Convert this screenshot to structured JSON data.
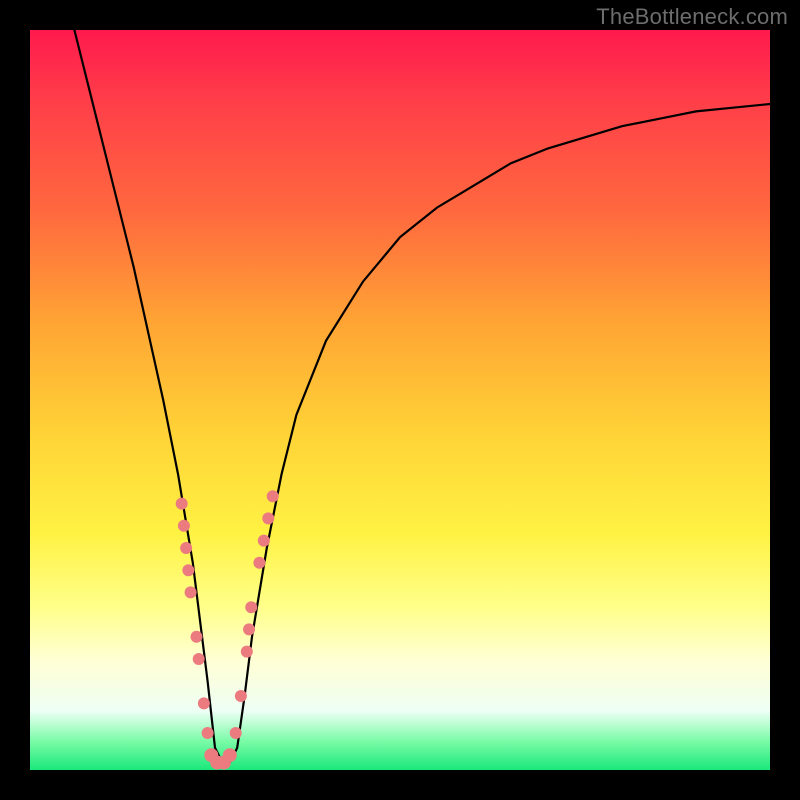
{
  "watermark": "TheBottleneck.com",
  "chart_data": {
    "type": "line",
    "title": "",
    "xlabel": "",
    "ylabel": "",
    "xlim": [
      0,
      100
    ],
    "ylim": [
      0,
      100
    ],
    "series": [
      {
        "name": "bottleneck-curve",
        "x": [
          6,
          8,
          10,
          12,
          14,
          16,
          18,
          20,
          21,
          22,
          23,
          24,
          25,
          26,
          27,
          28,
          29,
          30,
          32,
          34,
          36,
          40,
          45,
          50,
          55,
          60,
          65,
          70,
          75,
          80,
          85,
          90,
          95,
          100
        ],
        "y": [
          100,
          92,
          84,
          76,
          68,
          59,
          50,
          40,
          34,
          28,
          20,
          12,
          3,
          1,
          1,
          3,
          10,
          18,
          30,
          40,
          48,
          58,
          66,
          72,
          76,
          79,
          82,
          84,
          85.5,
          87,
          88,
          89,
          89.5,
          90
        ]
      }
    ],
    "markers": {
      "name": "highlighted-points",
      "color": "#ec7b80",
      "points": [
        {
          "x": 20.5,
          "y": 36,
          "r": 6
        },
        {
          "x": 20.8,
          "y": 33,
          "r": 6
        },
        {
          "x": 21.1,
          "y": 30,
          "r": 6
        },
        {
          "x": 21.4,
          "y": 27,
          "r": 6
        },
        {
          "x": 21.7,
          "y": 24,
          "r": 6
        },
        {
          "x": 22.5,
          "y": 18,
          "r": 6
        },
        {
          "x": 22.8,
          "y": 15,
          "r": 6
        },
        {
          "x": 23.5,
          "y": 9,
          "r": 6
        },
        {
          "x": 24.0,
          "y": 5,
          "r": 6
        },
        {
          "x": 24.5,
          "y": 2,
          "r": 7
        },
        {
          "x": 25.3,
          "y": 1,
          "r": 7
        },
        {
          "x": 26.2,
          "y": 1,
          "r": 7
        },
        {
          "x": 27.0,
          "y": 2,
          "r": 7
        },
        {
          "x": 27.8,
          "y": 5,
          "r": 6
        },
        {
          "x": 28.5,
          "y": 10,
          "r": 6
        },
        {
          "x": 29.3,
          "y": 16,
          "r": 6
        },
        {
          "x": 29.6,
          "y": 19,
          "r": 6
        },
        {
          "x": 29.9,
          "y": 22,
          "r": 6
        },
        {
          "x": 31.0,
          "y": 28,
          "r": 6
        },
        {
          "x": 31.6,
          "y": 31,
          "r": 6
        },
        {
          "x": 32.2,
          "y": 34,
          "r": 6
        },
        {
          "x": 32.8,
          "y": 37,
          "r": 6
        }
      ]
    }
  }
}
